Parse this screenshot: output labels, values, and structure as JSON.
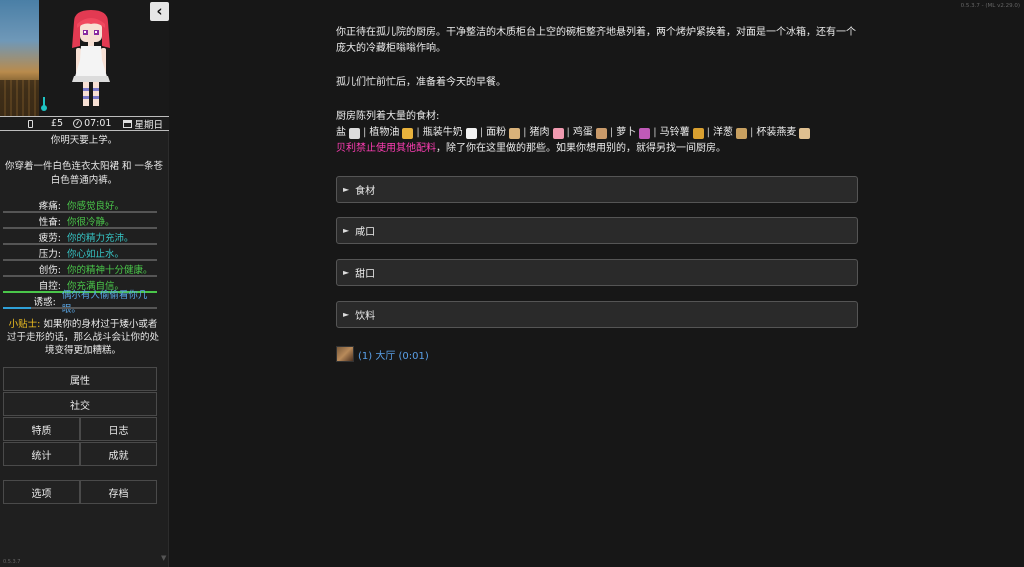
{
  "game": {
    "version": "0.5.3.7 - (ML v2.29.0)",
    "sidebar_version": "0.5.3.7"
  },
  "sidebar": {
    "collapse_icon": "chevron-left-icon",
    "status": {
      "money": "£5",
      "time": "07:01",
      "day": "星期日"
    },
    "notice": "你明天要上学。",
    "clothing": "你穿着一件白色连衣太阳裙 和 一条苍白色普通内裤。",
    "stats": [
      {
        "label": "疼痛:",
        "value": "你感觉良好。",
        "color": "green",
        "level": 0.0
      },
      {
        "label": "性奋:",
        "value": "你很冷静。",
        "color": "green",
        "level": 0.0
      },
      {
        "label": "疲劳:",
        "value": "你的精力充沛。",
        "color": "teal",
        "level": 0.0
      },
      {
        "label": "压力:",
        "value": "你心如止水。",
        "color": "teal",
        "level": 0.0
      },
      {
        "label": "创伤:",
        "value": "你的精神十分健康。",
        "color": "green",
        "level": 0.0
      },
      {
        "label": "自控:",
        "value": "你充满自信。",
        "color": "green",
        "level": 1.0
      },
      {
        "label": "诱惑:",
        "value": "偶尔有人偷偷看你几眼。",
        "color": "blue",
        "level": 0.18
      }
    ],
    "tip_label": "小贴士:",
    "tip_text": "如果你的身材过于矮小或者过于走形的话，那么战斗会让你的处境变得更加糟糕。",
    "menu": {
      "attributes": "属性",
      "social": "社交",
      "traits": "特质",
      "journal": "日志",
      "statistics": "统计",
      "achievements": "成就",
      "options": "选项",
      "saves": "存档"
    }
  },
  "main": {
    "paragraph1": "你正待在孤儿院的厨房。干净整洁的木质柜台上空的碗柜整齐地悬列着，两个烤炉紧挨着，对面是一个冰箱，还有一个庞大的冷藏柜嗡嗡作响。",
    "paragraph2": "孤儿们忙前忙后，准备着今天的早餐。",
    "ingredients_intro": "厨房陈列着大量的食材:",
    "ingredients": [
      {
        "name": "盐",
        "icon": "salt-icon",
        "color": "#dcdcdc"
      },
      {
        "name": "植物油",
        "icon": "oil-bottle-icon",
        "color": "#e8b23c"
      },
      {
        "name": "瓶装牛奶",
        "icon": "milk-bottle-icon",
        "color": "#f2f2f2"
      },
      {
        "name": "面粉",
        "icon": "flour-bag-icon",
        "color": "#d9b27a"
      },
      {
        "name": "猪肉",
        "icon": "pork-icon",
        "color": "#f09ab0"
      },
      {
        "name": "鸡蛋",
        "icon": "egg-icon",
        "color": "#c99a6a"
      },
      {
        "name": "萝卜",
        "icon": "radish-icon",
        "color": "#c05ab8"
      },
      {
        "name": "马铃薯",
        "icon": "potato-icon",
        "color": "#d9a030"
      },
      {
        "name": "洋葱",
        "icon": "onion-icon",
        "color": "#c8a060"
      },
      {
        "name": "杯装燕麦",
        "icon": "oats-icon",
        "color": "#e0c090"
      }
    ],
    "warning_pink": "贝利禁止使用其他配料",
    "warning_rest": "，除了你在这里做的那些。如果你想用别的，就得另找一间厨房。",
    "sections": [
      {
        "label": "食材"
      },
      {
        "label": "咸口"
      },
      {
        "label": "甜口"
      },
      {
        "label": "饮料"
      }
    ],
    "room_link": "(1) 大厅 (0:01)"
  }
}
